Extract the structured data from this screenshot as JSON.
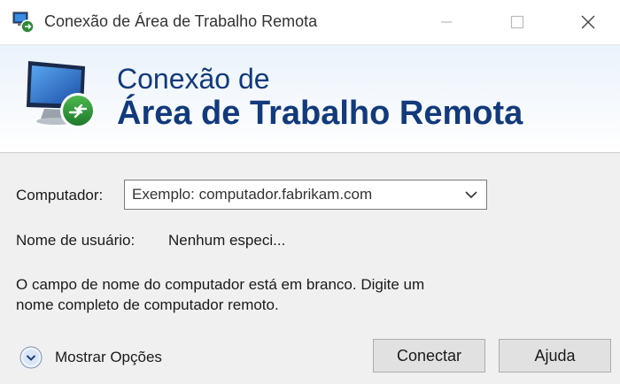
{
  "window": {
    "title": "Conexão de Área de Trabalho Remota",
    "controls": [
      "minimize",
      "maximize",
      "close"
    ]
  },
  "banner": {
    "line1": "Conexão de",
    "line2": "Área de Trabalho Remota",
    "icon": "remote-desktop-monitor-icon",
    "title_color": "#123a7c"
  },
  "form": {
    "computer_label": "Computador:",
    "computer_placeholder": "Exemplo: computador.fabrikam.com",
    "computer_value": "",
    "username_label": "Nome de usuário:",
    "username_value": "Nenhum especi...",
    "message_line1": "O campo de nome do computador está em branco. Digite um",
    "message_line2": "nome completo de computador remoto."
  },
  "footer": {
    "show_options_label": "Mostrar Opções",
    "connect_label": "Conectar",
    "help_label": "Ajuda"
  }
}
